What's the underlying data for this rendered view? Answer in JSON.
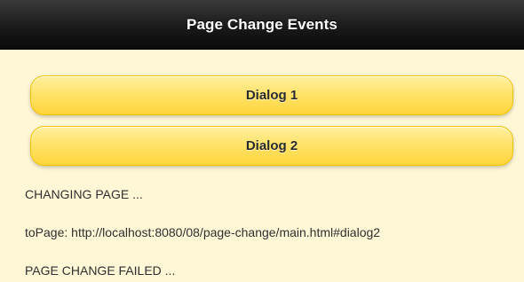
{
  "header": {
    "title": "Page Change Events"
  },
  "buttons": {
    "dialog1_label": "Dialog 1",
    "dialog2_label": "Dialog 2"
  },
  "log": {
    "lines": [
      "CHANGING PAGE ...",
      "toPage: http://localhost:8080/08/page-change/main.html#dialog2",
      "PAGE CHANGE FAILED ..."
    ]
  },
  "colors": {
    "header_background": "#1a1a1a",
    "header_text": "#ffffff",
    "content_background": "#fff7d6",
    "button_gradient_top": "#fff0a0",
    "button_gradient_bottom": "#ffd53a",
    "button_border": "#f1c400",
    "text": "#2f2f2f"
  }
}
